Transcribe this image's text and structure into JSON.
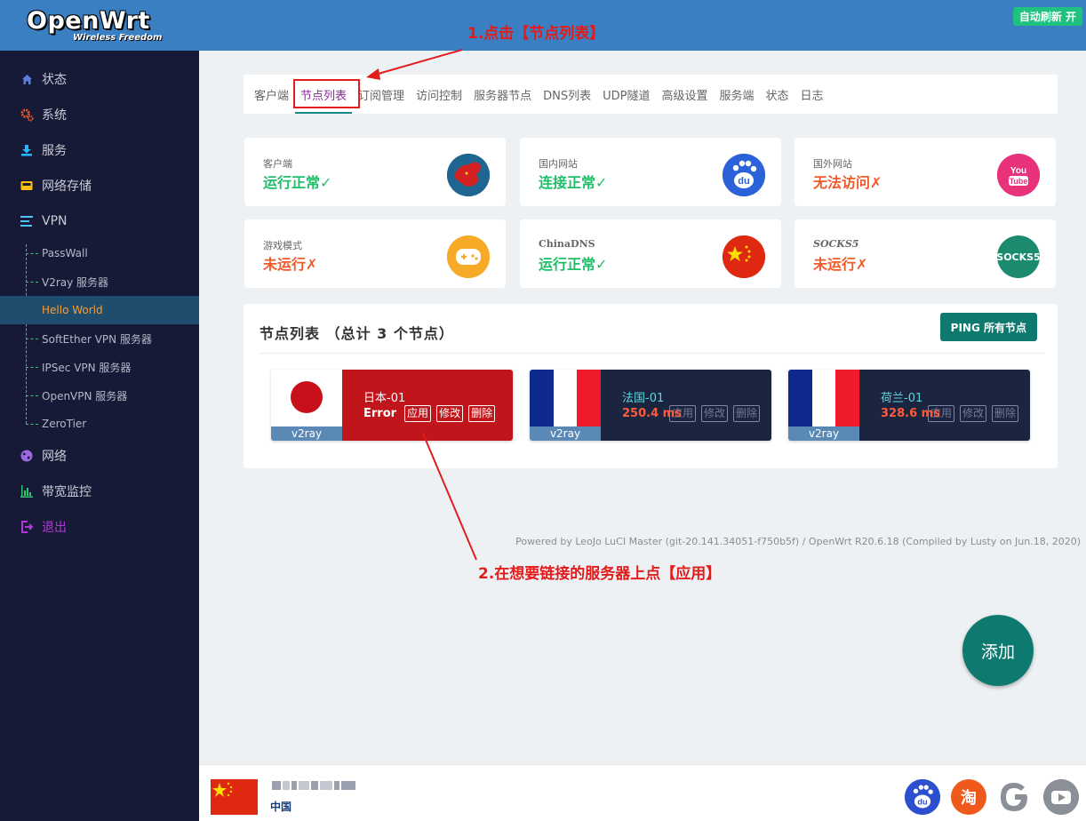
{
  "header": {
    "logo_main": "OpenWrt",
    "logo_sub": "Wireless Freedom",
    "auto_refresh": "自动刷新 开"
  },
  "sidebar": {
    "items": [
      {
        "label": "状态",
        "icon": "home-icon",
        "color": "#5b7fd6"
      },
      {
        "label": "系统",
        "icon": "gear-icon",
        "color": "#f05a28"
      },
      {
        "label": "服务",
        "icon": "download-icon",
        "color": "#29b6f6"
      },
      {
        "label": "网络存储",
        "icon": "storage-icon",
        "color": "#ffc107"
      },
      {
        "label": "VPN",
        "icon": "list-icon",
        "color": "#4fc3f7"
      },
      {
        "label": "网络",
        "icon": "globe-icon",
        "color": "#9c6ade"
      },
      {
        "label": "带宽监控",
        "icon": "bar-chart-icon",
        "color": "#2fc46d"
      },
      {
        "label": "退出",
        "icon": "logout-icon",
        "color": "#b03ad6"
      }
    ],
    "vpn_sub": [
      "PassWall",
      "V2ray 服务器",
      "Hello World",
      "SoftEther VPN 服务器",
      "IPSec VPN 服务器",
      "OpenVPN 服务器",
      "ZeroTier"
    ],
    "active_sub": "Hello World"
  },
  "tabs": [
    "客户端",
    "节点列表",
    "订阅管理",
    "访问控制",
    "服务器节点",
    "DNS列表",
    "UDP隧道",
    "高级设置",
    "服务端",
    "状态",
    "日志"
  ],
  "active_tab": "节点列表",
  "status_cards": [
    {
      "label": "客户端",
      "value": "运行正常✓",
      "state": "ok",
      "icon": "china-map-icon"
    },
    {
      "label": "国内网站",
      "value": "连接正常✓",
      "state": "ok",
      "icon": "baidu-icon"
    },
    {
      "label": "国外网站",
      "value": "无法访问✗",
      "state": "bad",
      "icon": "youtube-icon"
    },
    {
      "label": "游戏模式",
      "value": "未运行✗",
      "state": "bad",
      "icon": "gamepad-icon"
    },
    {
      "label": "ChinaDNS",
      "value": "运行正常✓",
      "state": "ok",
      "icon": "china-flag-icon"
    },
    {
      "label": "SOCKS5",
      "value": "未运行✗",
      "state": "bad",
      "icon": "socks5-icon",
      "icon_text": "SOCKS5"
    }
  ],
  "node_list": {
    "title": "节点列表 （总计  3 个节点）",
    "ping_all": "PING 所有节点",
    "nodes": [
      {
        "name": "日本-01",
        "type": "v2ray",
        "status": "Error",
        "flag": "japan-flag",
        "apply": "应用",
        "edit": "修改",
        "delete": "删除"
      },
      {
        "name": "法国-01",
        "type": "v2ray",
        "status": "250.4 ms",
        "flag": "france-flag",
        "apply": "应用",
        "edit": "修改",
        "delete": "删除"
      },
      {
        "name": "荷兰-01",
        "type": "v2ray",
        "status": "328.6 ms",
        "flag": "france-flag",
        "apply": "应用",
        "edit": "修改",
        "delete": "删除"
      }
    ]
  },
  "footer": "Powered by LeoJo LuCI Master (git-20.141.34051-f750b5f) / OpenWrt R20.6.18 (Compiled by Lusty on Jun.18, 2020)",
  "annotations": {
    "step1": "1.点击【节点列表】",
    "step2": "2.在想要链接的服务器上点【应用】"
  },
  "add_button": "添加",
  "bottom_bar": {
    "region": "中国",
    "icons": [
      "baidu-icon",
      "taobao-icon",
      "google-icon",
      "youtube-icon"
    ],
    "taobao_text": "淘"
  }
}
